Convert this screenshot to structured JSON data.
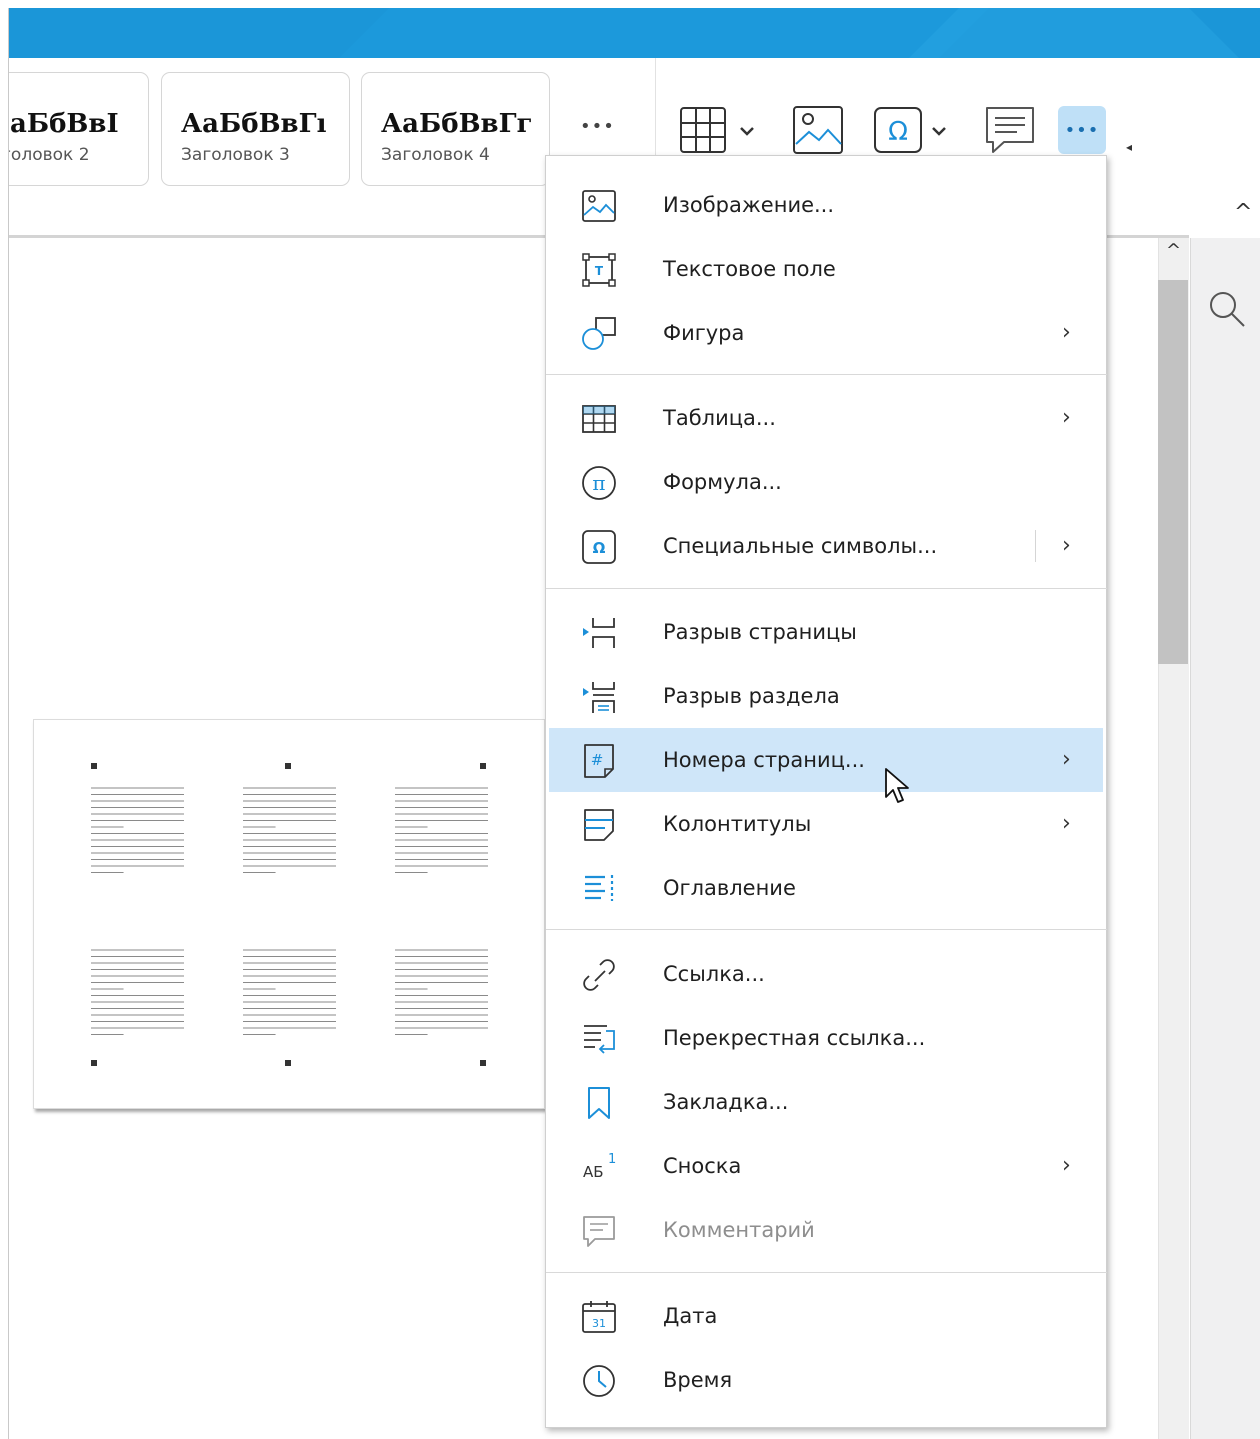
{
  "colors": {
    "titlebar": "#1b96d8",
    "highlight": "#cfe6f9",
    "icon_blue": "#1c8fd8"
  },
  "ribbon": {
    "styles": [
      {
        "sample": "аБбВвI",
        "name": "головок 2"
      },
      {
        "sample": "АаБбВвГı",
        "name": "Заголовок 3"
      },
      {
        "sample": "АаБбВвГг",
        "name": "Заголовок 4"
      }
    ],
    "more_styles_label": "•••",
    "toolbar": {
      "table_icon": "table-icon",
      "image_icon": "image-icon",
      "special_symbols_icon": "omega-icon",
      "comment_icon": "comment-icon",
      "more_label": "•••",
      "collapse_label": "^"
    }
  },
  "menu": {
    "items": [
      {
        "id": "image",
        "label": "Изображение...",
        "icon": "image-icon",
        "submenu": false
      },
      {
        "id": "textbox",
        "label": "Текстовое поле",
        "icon": "text-box-icon",
        "submenu": false
      },
      {
        "id": "shape",
        "label": "Фигура",
        "icon": "shape-icon",
        "submenu": true,
        "submenu_label": "›"
      },
      {
        "id": "table",
        "label": "Таблица...",
        "icon": "table-icon",
        "submenu": true,
        "submenu_label": "›"
      },
      {
        "id": "formula",
        "label": "Формула...",
        "icon": "pi-icon",
        "submenu": false
      },
      {
        "id": "special",
        "label": "Специальные символы...",
        "icon": "omega-icon",
        "submenu": true,
        "submenu_label": "›"
      },
      {
        "id": "page_break",
        "label": "Разрыв страницы",
        "icon": "page-break-icon",
        "submenu": false
      },
      {
        "id": "section_break",
        "label": "Разрыв раздела",
        "icon": "section-break-icon",
        "submenu": false
      },
      {
        "id": "page_numbers",
        "label": "Номера страниц...",
        "icon": "page-number-icon",
        "submenu": true,
        "submenu_label": "›",
        "highlighted": true
      },
      {
        "id": "headers",
        "label": "Колонтитулы",
        "icon": "header-footer-icon",
        "submenu": true,
        "submenu_label": "›"
      },
      {
        "id": "toc",
        "label": "Оглавление",
        "icon": "toc-icon",
        "submenu": false
      },
      {
        "id": "link",
        "label": "Ссылка...",
        "icon": "link-icon",
        "submenu": false
      },
      {
        "id": "cross_ref",
        "label": "Перекрестная ссылка...",
        "icon": "cross-reference-icon",
        "submenu": false
      },
      {
        "id": "bookmark",
        "label": "Закладка...",
        "icon": "bookmark-icon",
        "submenu": false
      },
      {
        "id": "footnote",
        "label": "Сноска",
        "icon": "footnote-icon",
        "submenu": true,
        "submenu_label": "›"
      },
      {
        "id": "comment",
        "label": "Комментарий",
        "icon": "comment-icon",
        "submenu": false,
        "disabled": true
      },
      {
        "id": "date",
        "label": "Дата",
        "icon": "calendar-icon",
        "submenu": false
      },
      {
        "id": "time",
        "label": "Время",
        "icon": "clock-icon",
        "submenu": false
      }
    ],
    "footnote_icon_text": "АБ",
    "footnote_icon_sup": "1",
    "calendar_icon_text": "31"
  }
}
